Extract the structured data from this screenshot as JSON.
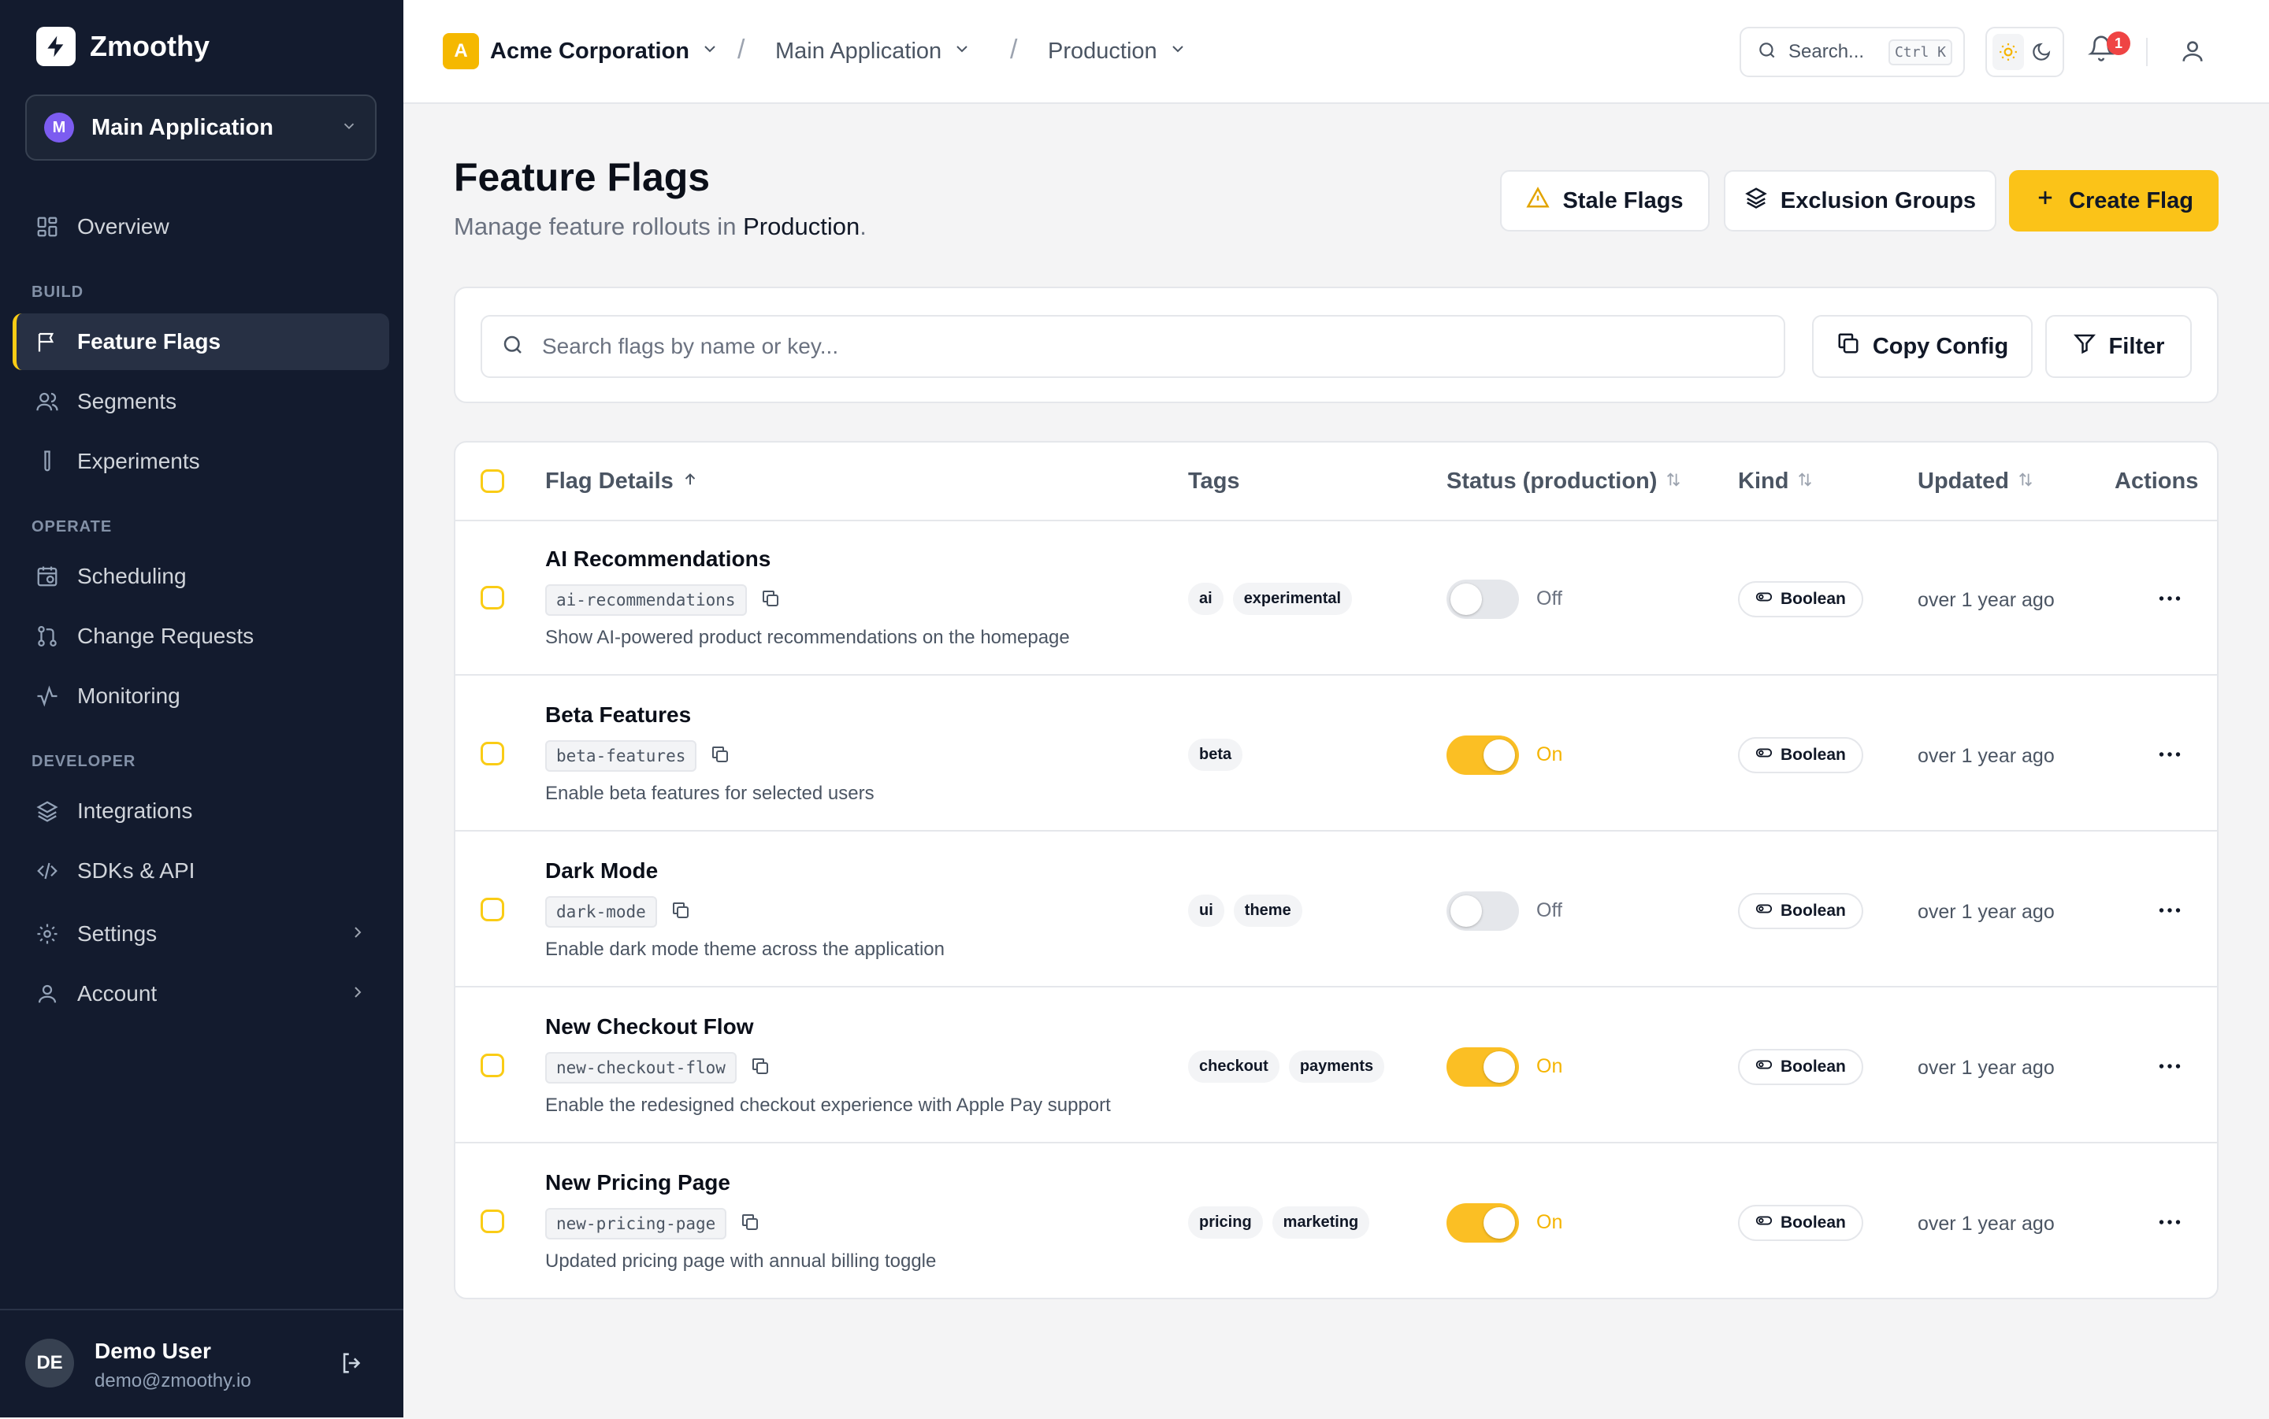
{
  "brand": {
    "name": "Zmoothy"
  },
  "app_switcher": {
    "badge": "M",
    "label": "Main Application"
  },
  "nav": {
    "overview": "Overview",
    "section_build": "BUILD",
    "feature_flags": "Feature Flags",
    "segments": "Segments",
    "experiments": "Experiments",
    "section_operate": "OPERATE",
    "scheduling": "Scheduling",
    "change_requests": "Change Requests",
    "monitoring": "Monitoring",
    "section_developer": "DEVELOPER",
    "integrations": "Integrations",
    "sdks_api": "SDKs & API",
    "settings": "Settings",
    "account": "Account"
  },
  "user": {
    "initials": "DE",
    "name": "Demo User",
    "email": "demo@zmoothy.io"
  },
  "topbar": {
    "org_badge": "A",
    "org": "Acme Corporation",
    "app": "Main Application",
    "env": "Production",
    "separator": "/",
    "search_placeholder": "Search...",
    "search_shortcut": "Ctrl K",
    "notification_count": "1"
  },
  "page": {
    "title": "Feature Flags",
    "subtitle_prefix": "Manage feature rollouts in ",
    "subtitle_env": "Production",
    "subtitle_suffix": ".",
    "stale_flags": "Stale Flags",
    "exclusion_groups": "Exclusion Groups",
    "create_flag": "Create Flag"
  },
  "search": {
    "placeholder": "Search flags by name or key...",
    "copy_config": "Copy Config",
    "filter": "Filter"
  },
  "table": {
    "headers": {
      "flag_details": "Flag Details",
      "tags": "Tags",
      "status": "Status (production)",
      "kind": "Kind",
      "updated": "Updated",
      "actions": "Actions"
    },
    "rows": [
      {
        "name": "AI Recommendations",
        "key": "ai-recommendations",
        "description": "Show AI-powered product recommendations on the homepage",
        "tags": [
          "ai",
          "experimental"
        ],
        "enabled": false,
        "status": "Off",
        "kind": "Boolean",
        "updated": "over 1 year ago"
      },
      {
        "name": "Beta Features",
        "key": "beta-features",
        "description": "Enable beta features for selected users",
        "tags": [
          "beta"
        ],
        "enabled": true,
        "status": "On",
        "kind": "Boolean",
        "updated": "over 1 year ago"
      },
      {
        "name": "Dark Mode",
        "key": "dark-mode",
        "description": "Enable dark mode theme across the application",
        "tags": [
          "ui",
          "theme"
        ],
        "enabled": false,
        "status": "Off",
        "kind": "Boolean",
        "updated": "over 1 year ago"
      },
      {
        "name": "New Checkout Flow",
        "key": "new-checkout-flow",
        "description": "Enable the redesigned checkout experience with Apple Pay support",
        "tags": [
          "checkout",
          "payments"
        ],
        "enabled": true,
        "status": "On",
        "kind": "Boolean",
        "updated": "over 1 year ago"
      },
      {
        "name": "New Pricing Page",
        "key": "new-pricing-page",
        "description": "Updated pricing page with annual billing toggle",
        "tags": [
          "pricing",
          "marketing"
        ],
        "enabled": true,
        "status": "On",
        "kind": "Boolean",
        "updated": "over 1 year ago"
      }
    ]
  },
  "colors": {
    "accent": "#fbc318",
    "sidebar_bg": "#131b2e",
    "toggle_on": "#fbbf24",
    "toggle_off": "#e5e7eb"
  }
}
